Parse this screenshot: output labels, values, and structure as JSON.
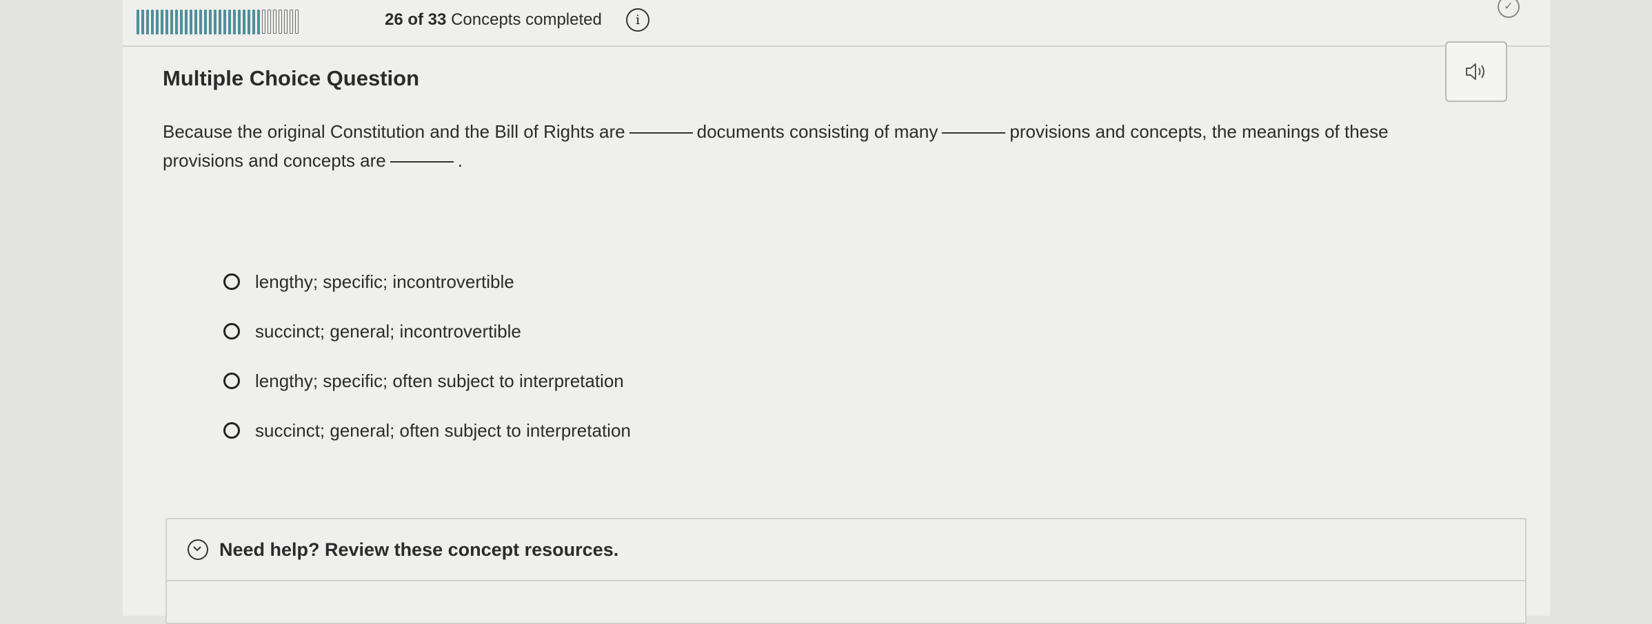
{
  "progress": {
    "completed": 26,
    "total": 33,
    "text_count": "26 of 33",
    "text_suffix": "Concepts completed"
  },
  "icons": {
    "info": "info-icon",
    "status": "check-circle-icon",
    "audio": "speaker-icon",
    "help_toggle": "chevron-down-icon"
  },
  "question": {
    "type_label": "Multiple Choice Question",
    "prompt_part1": "Because the original Constitution and the Bill of Rights are",
    "prompt_part2": "documents consisting of many",
    "prompt_part3": "provisions and concepts, the meanings of these provisions and concepts are",
    "prompt_end": ".",
    "options": [
      "lengthy; specific; incontrovertible",
      "succinct; general; incontrovertible",
      "lengthy; specific; often subject to interpretation",
      "succinct; general; often subject to interpretation"
    ]
  },
  "help": {
    "label": "Need help? Review these concept resources."
  },
  "colors": {
    "progress_fill": "#4f8f9a",
    "page_bg": "#efefed",
    "text": "#2b2b2b"
  }
}
